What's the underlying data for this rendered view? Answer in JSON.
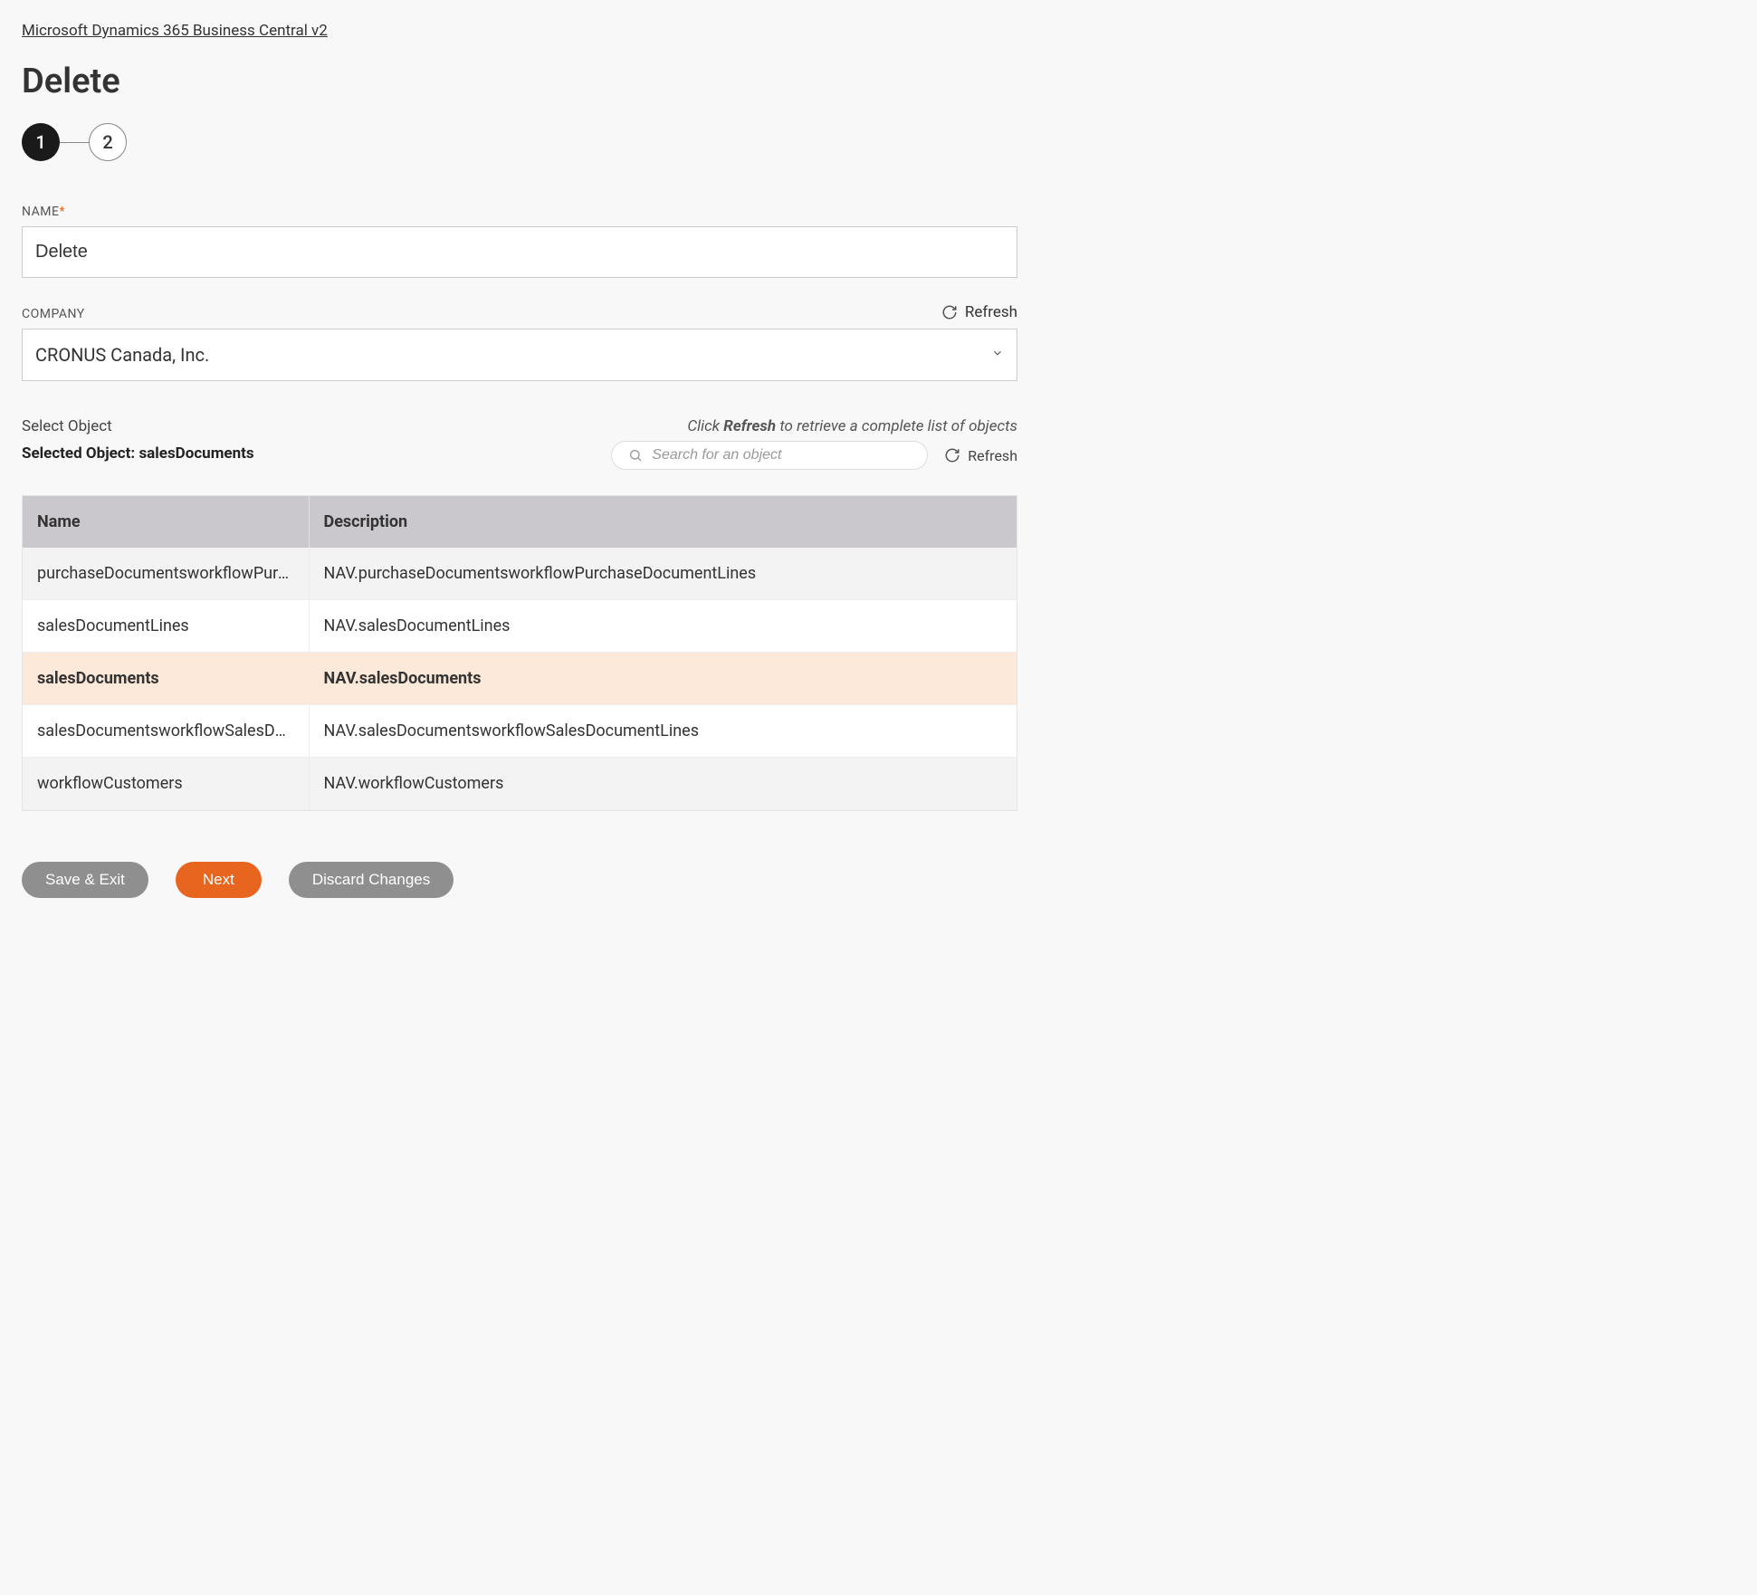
{
  "breadcrumb": "Microsoft Dynamics 365 Business Central v2",
  "pageTitle": "Delete",
  "stepper": {
    "step1": "1",
    "step2": "2"
  },
  "nameField": {
    "label": "NAME",
    "value": "Delete"
  },
  "companyField": {
    "label": "COMPANY",
    "value": "CRONUS Canada, Inc."
  },
  "refreshLabel": "Refresh",
  "selectObject": {
    "label": "Select Object",
    "selectedPrefix": "Selected Object: ",
    "selectedValue": "salesDocuments",
    "hintPrefix": "Click ",
    "hintBold": "Refresh",
    "hintSuffix": " to retrieve a complete list of objects",
    "searchPlaceholder": "Search for an object"
  },
  "table": {
    "headers": {
      "name": "Name",
      "description": "Description"
    },
    "rows": [
      {
        "name": "purchaseDocumentsworkflowPurc…",
        "description": "NAV.purchaseDocumentsworkflowPurchaseDocumentLines",
        "selected": false
      },
      {
        "name": "salesDocumentLines",
        "description": "NAV.salesDocumentLines",
        "selected": false
      },
      {
        "name": "salesDocuments",
        "description": "NAV.salesDocuments",
        "selected": true
      },
      {
        "name": "salesDocumentsworkflowSalesDoc…",
        "description": "NAV.salesDocumentsworkflowSalesDocumentLines",
        "selected": false
      },
      {
        "name": "workflowCustomers",
        "description": "NAV.workflowCustomers",
        "selected": false
      }
    ]
  },
  "footer": {
    "saveExit": "Save & Exit",
    "next": "Next",
    "discard": "Discard Changes"
  }
}
